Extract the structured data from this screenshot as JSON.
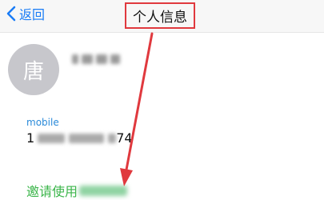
{
  "navbar": {
    "back_label": "返回",
    "title": "个人信息"
  },
  "profile": {
    "avatar_char": "唐"
  },
  "contact": {
    "mobile_label": "mobile",
    "mobile_visible_start": "1",
    "mobile_visible_end": "74"
  },
  "invite": {
    "label": "邀请使用"
  },
  "colors": {
    "ios_blue": "#1a7cf6",
    "annotation_red": "#e0393e",
    "invite_green": "#3bb54a",
    "avatar_gray": "#c7c7cc"
  },
  "icons": {
    "back": "chevron-left-icon",
    "annotation": "red-arrow-annotation"
  }
}
